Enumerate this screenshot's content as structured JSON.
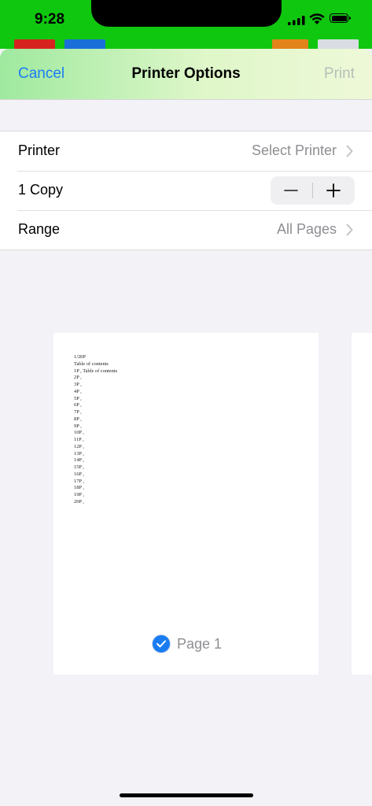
{
  "status_bar": {
    "time": "9:28"
  },
  "app_colors": {
    "app_bar": "#10c710",
    "accent": "#1a7cf3"
  },
  "sheet": {
    "cancel_label": "Cancel",
    "title": "Printer Options",
    "print_label": "Print",
    "options": {
      "printer_label": "Printer",
      "printer_value": "Select Printer",
      "copies_label": "1 Copy",
      "range_label": "Range",
      "range_value": "All Pages"
    }
  },
  "preview": {
    "lines": [
      "1/20P",
      "Table of contents",
      "1P , Table of contents",
      "2P ,",
      "3P ,",
      "4P ,",
      "5P ,",
      "6P ,",
      "7P ,",
      "8P ,",
      "9P ,",
      "10P ,",
      "11P ,",
      "12P ,",
      "13P ,",
      "14P ,",
      "15P ,",
      "16P ,",
      "17P ,",
      "18P ,",
      "19P ,",
      "20P ,"
    ],
    "page_label": "Page 1"
  }
}
